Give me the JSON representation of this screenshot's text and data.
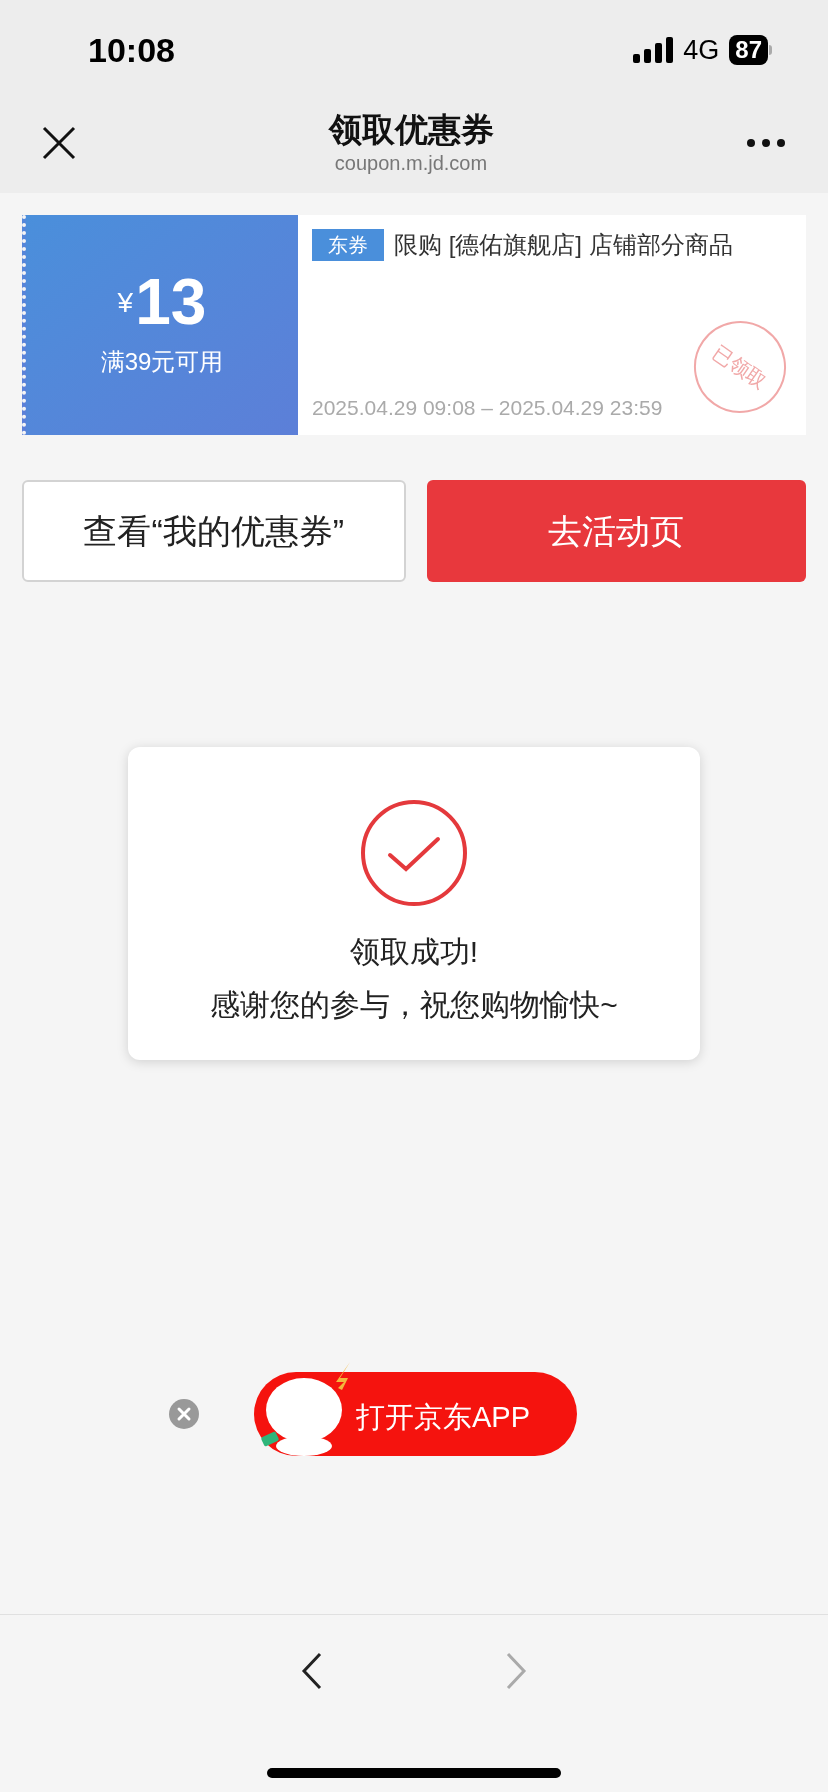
{
  "status_bar": {
    "time": "10:08",
    "network": "4G",
    "battery": "87"
  },
  "nav": {
    "title": "领取优惠券",
    "subtitle": "coupon.m.jd.com"
  },
  "coupon": {
    "currency": "¥",
    "amount": "13",
    "condition": "满39元可用",
    "tag": "东券",
    "description": "限购 [德佑旗舰店] 店铺部分商品",
    "validity": "2025.04.29 09:08 – 2025.04.29 23:59",
    "stamp": "已领取"
  },
  "buttons": [
    {
      "kind": "outline",
      "label": "查看“我的优惠券”"
    },
    {
      "kind": "primary",
      "label": "去活动页"
    }
  ],
  "dialog": {
    "title": "领取成功!",
    "message": "感谢您的参与，祝您购物愉快~"
  },
  "app_banner": {
    "label": "打开京东APP"
  },
  "browser_bar": {
    "back_disabled": false,
    "forward_disabled": true
  }
}
